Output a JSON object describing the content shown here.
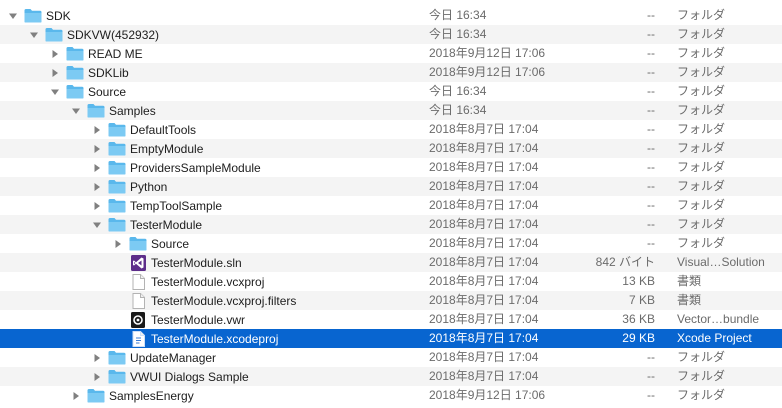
{
  "colors": {
    "folder": "#5ab8ec",
    "folder_tab": "#7ccaf3",
    "selection": "#0865d0",
    "row_alt": "#f4f4f4",
    "secondary_text": "#6b6b6b"
  },
  "rows": [
    {
      "name": "SDK",
      "date": "今日 16:34",
      "size": "--",
      "kind": "フォルダ",
      "icon": "folder-icon",
      "expanded": true
    },
    {
      "name": "SDKVW(452932)",
      "date": "今日 16:34",
      "size": "--",
      "kind": "フォルダ",
      "icon": "folder-icon",
      "expanded": true
    },
    {
      "name": "READ ME",
      "date": "2018年9月12日 17:06",
      "size": "--",
      "kind": "フォルダ",
      "icon": "folder-icon",
      "expanded": false
    },
    {
      "name": "SDKLib",
      "date": "2018年9月12日 17:06",
      "size": "--",
      "kind": "フォルダ",
      "icon": "folder-icon",
      "expanded": false
    },
    {
      "name": "Source",
      "date": "今日 16:34",
      "size": "--",
      "kind": "フォルダ",
      "icon": "folder-icon",
      "expanded": true
    },
    {
      "name": "Samples",
      "date": "今日 16:34",
      "size": "--",
      "kind": "フォルダ",
      "icon": "folder-icon",
      "expanded": true
    },
    {
      "name": "DefaultTools",
      "date": "2018年8月7日 17:04",
      "size": "--",
      "kind": "フォルダ",
      "icon": "folder-icon",
      "expanded": false
    },
    {
      "name": "EmptyModule",
      "date": "2018年8月7日 17:04",
      "size": "--",
      "kind": "フォルダ",
      "icon": "folder-icon",
      "expanded": false
    },
    {
      "name": "ProvidersSampleModule",
      "date": "2018年8月7日 17:04",
      "size": "--",
      "kind": "フォルダ",
      "icon": "folder-icon",
      "expanded": false
    },
    {
      "name": "Python",
      "date": "2018年8月7日 17:04",
      "size": "--",
      "kind": "フォルダ",
      "icon": "folder-icon",
      "expanded": false
    },
    {
      "name": "TempToolSample",
      "date": "2018年8月7日 17:04",
      "size": "--",
      "kind": "フォルダ",
      "icon": "folder-icon",
      "expanded": false
    },
    {
      "name": "TesterModule",
      "date": "2018年8月7日 17:04",
      "size": "--",
      "kind": "フォルダ",
      "icon": "folder-icon",
      "expanded": true
    },
    {
      "name": "Source",
      "date": "2018年8月7日 17:04",
      "size": "--",
      "kind": "フォルダ",
      "icon": "folder-icon",
      "expanded": false
    },
    {
      "name": "TesterModule.sln",
      "date": "2018年8月7日 17:04",
      "size": "842 バイト",
      "kind": "Visual…Solution",
      "icon": "visual-studio-solution-icon"
    },
    {
      "name": "TesterModule.vcxproj",
      "date": "2018年8月7日 17:04",
      "size": "13 KB",
      "kind": "書類",
      "icon": "document-icon"
    },
    {
      "name": "TesterModule.vcxproj.filters",
      "date": "2018年8月7日 17:04",
      "size": "7 KB",
      "kind": "書類",
      "icon": "document-icon"
    },
    {
      "name": "TesterModule.vwr",
      "date": "2018年8月7日 17:04",
      "size": "36 KB",
      "kind": "Vector…bundle",
      "icon": "vectorworks-bundle-icon"
    },
    {
      "name": "TesterModule.xcodeproj",
      "date": "2018年8月7日 17:04",
      "size": "29 KB",
      "kind": "Xcode Project",
      "icon": "xcode-project-icon",
      "selected": true
    },
    {
      "name": "UpdateManager",
      "date": "2018年8月7日 17:04",
      "size": "--",
      "kind": "フォルダ",
      "icon": "folder-icon",
      "expanded": false
    },
    {
      "name": "VWUI Dialogs Sample",
      "date": "2018年8月7日 17:04",
      "size": "--",
      "kind": "フォルダ",
      "icon": "folder-icon",
      "expanded": false
    },
    {
      "name": "SamplesEnergy",
      "date": "2018年9月12日 17:06",
      "size": "--",
      "kind": "フォルダ",
      "icon": "folder-icon",
      "expanded": false
    }
  ]
}
